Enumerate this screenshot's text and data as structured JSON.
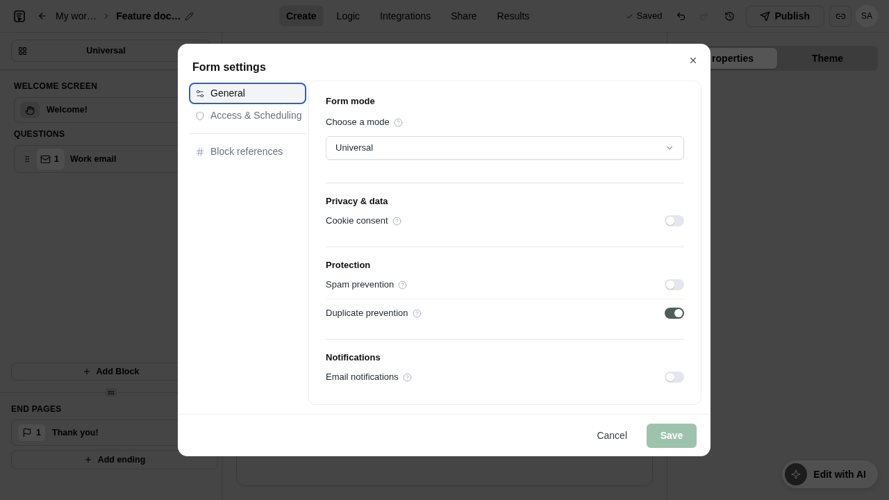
{
  "top_bar": {
    "breadcrumb": [
      "My wor…",
      "Feature doc…"
    ],
    "tabs": [
      {
        "label": "Create",
        "selected": true
      },
      {
        "label": "Logic",
        "selected": false
      },
      {
        "label": "Integrations",
        "selected": false
      },
      {
        "label": "Share",
        "selected": false
      },
      {
        "label": "Results",
        "selected": false
      }
    ],
    "save_status": "Saved",
    "history_buttons": [
      {
        "disabled": false
      },
      {
        "disabled": true
      },
      {
        "disabled": false
      }
    ],
    "publish_button": "Publish",
    "avatar": "SA"
  },
  "sidebar": {
    "mode_select": "Universal",
    "sections": [
      {
        "title": "WELCOME SCREEN",
        "items": [
          {
            "kind": "welcome",
            "label": "Welcome!"
          }
        ]
      },
      {
        "title": "QUESTIONS",
        "items": [
          {
            "kind": "question",
            "number": "1",
            "label": "Work email"
          }
        ]
      }
    ],
    "add_block_button": "Add Block",
    "end_pages": {
      "title": "END PAGES",
      "items": [
        {
          "number": "1",
          "label": "Thank you!"
        }
      ]
    },
    "add_ending_button": "Add ending"
  },
  "properties_panel": {
    "tabs": [
      {
        "label": "roperties",
        "selected": true
      },
      {
        "label": "Theme",
        "selected": false
      }
    ],
    "ai_button": "Edit with AI"
  },
  "modal": {
    "title": "Form settings",
    "nav": [
      {
        "label": "General",
        "selected": true
      },
      {
        "label": "Access & Scheduling",
        "selected": false
      }
    ],
    "nav_extra": [
      {
        "label": "Block references",
        "selected": false
      }
    ],
    "sections": [
      {
        "title": "Form mode",
        "rows": [
          {
            "kind": "select",
            "label": "Choose a mode",
            "value": "Universal"
          }
        ]
      },
      {
        "title": "Privacy & data",
        "rows": [
          {
            "kind": "toggle",
            "label": "Cookie consent",
            "on": false
          }
        ]
      },
      {
        "title": "Protection",
        "rows": [
          {
            "kind": "toggle",
            "label": "Spam prevention",
            "on": false
          },
          {
            "kind": "toggle",
            "label": "Duplicate prevention",
            "on": true
          }
        ]
      },
      {
        "title": "Notifications",
        "rows": [
          {
            "kind": "toggle",
            "label": "Email notifications",
            "on": false
          }
        ]
      }
    ],
    "cancel_button": "Cancel",
    "save_button": {
      "label": "Save",
      "disabled": true
    }
  }
}
